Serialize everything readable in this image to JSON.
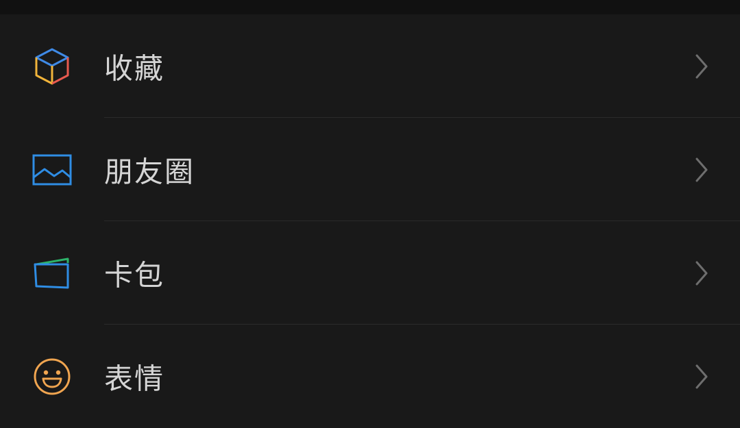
{
  "menu": {
    "items": [
      {
        "label": "收藏",
        "icon": "favorites-cube-icon"
      },
      {
        "label": "朋友圈",
        "icon": "moments-image-icon"
      },
      {
        "label": "卡包",
        "icon": "card-wallet-icon"
      },
      {
        "label": "表情",
        "icon": "sticker-smiley-icon"
      }
    ]
  },
  "colors": {
    "background": "#191919",
    "text": "#d5d5d5",
    "chevron": "#6e6e6e",
    "divider": "#2b2b2b",
    "favorites_yellow": "#f1b43a",
    "favorites_blue": "#3f8ae6",
    "favorites_red": "#e85a4f",
    "moments_blue": "#2f8de4",
    "card_blue": "#2f8de4",
    "card_green": "#2db36a",
    "sticker_orange": "#f0a550"
  }
}
